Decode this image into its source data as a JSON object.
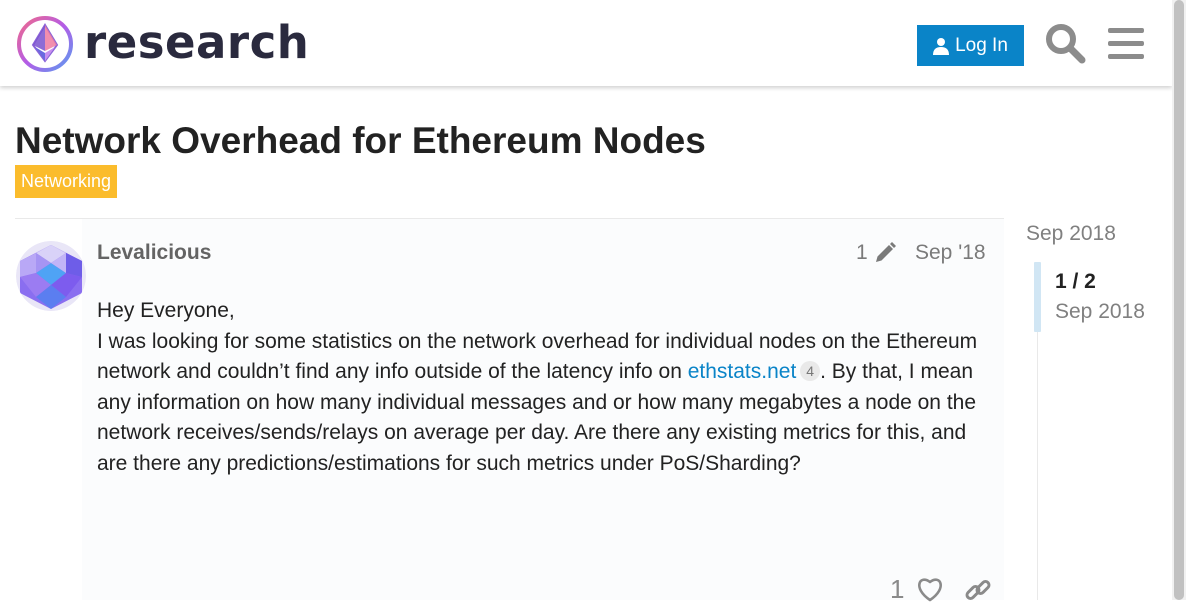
{
  "header": {
    "site_name": "research",
    "login_label": "Log In"
  },
  "topic": {
    "title": "Network Overhead for Ethereum Nodes",
    "category": "Networking"
  },
  "post": {
    "username": "Levalicious",
    "edit_count": "1",
    "date": "Sep '18",
    "greeting": "Hey Everyone,",
    "body_before_link": "I was looking for some statistics on the network overhead for individual nodes on the Ethereum network and couldn’t find any info outside of the latency info on ",
    "link_text": "ethstats.net",
    "link_clicks": "4",
    "body_after_link": ". By that, I mean any information on how many individual messages and or how many megabytes a node on the network receives/sends/relays on average per day. Are there any existing metrics for this, and are there any predictions/estimations for such metrics under PoS/Sharding?",
    "like_count": "1"
  },
  "timeline": {
    "start_label": "Sep 2018",
    "position": "1 / 2",
    "current_date": "Sep 2018"
  },
  "colors": {
    "accent": "#0a84c8",
    "category": "#fbbc2c"
  },
  "icons": [
    "logo-icon",
    "user-icon",
    "search-icon",
    "menu-icon",
    "pencil-icon",
    "heart-icon",
    "link-icon"
  ]
}
